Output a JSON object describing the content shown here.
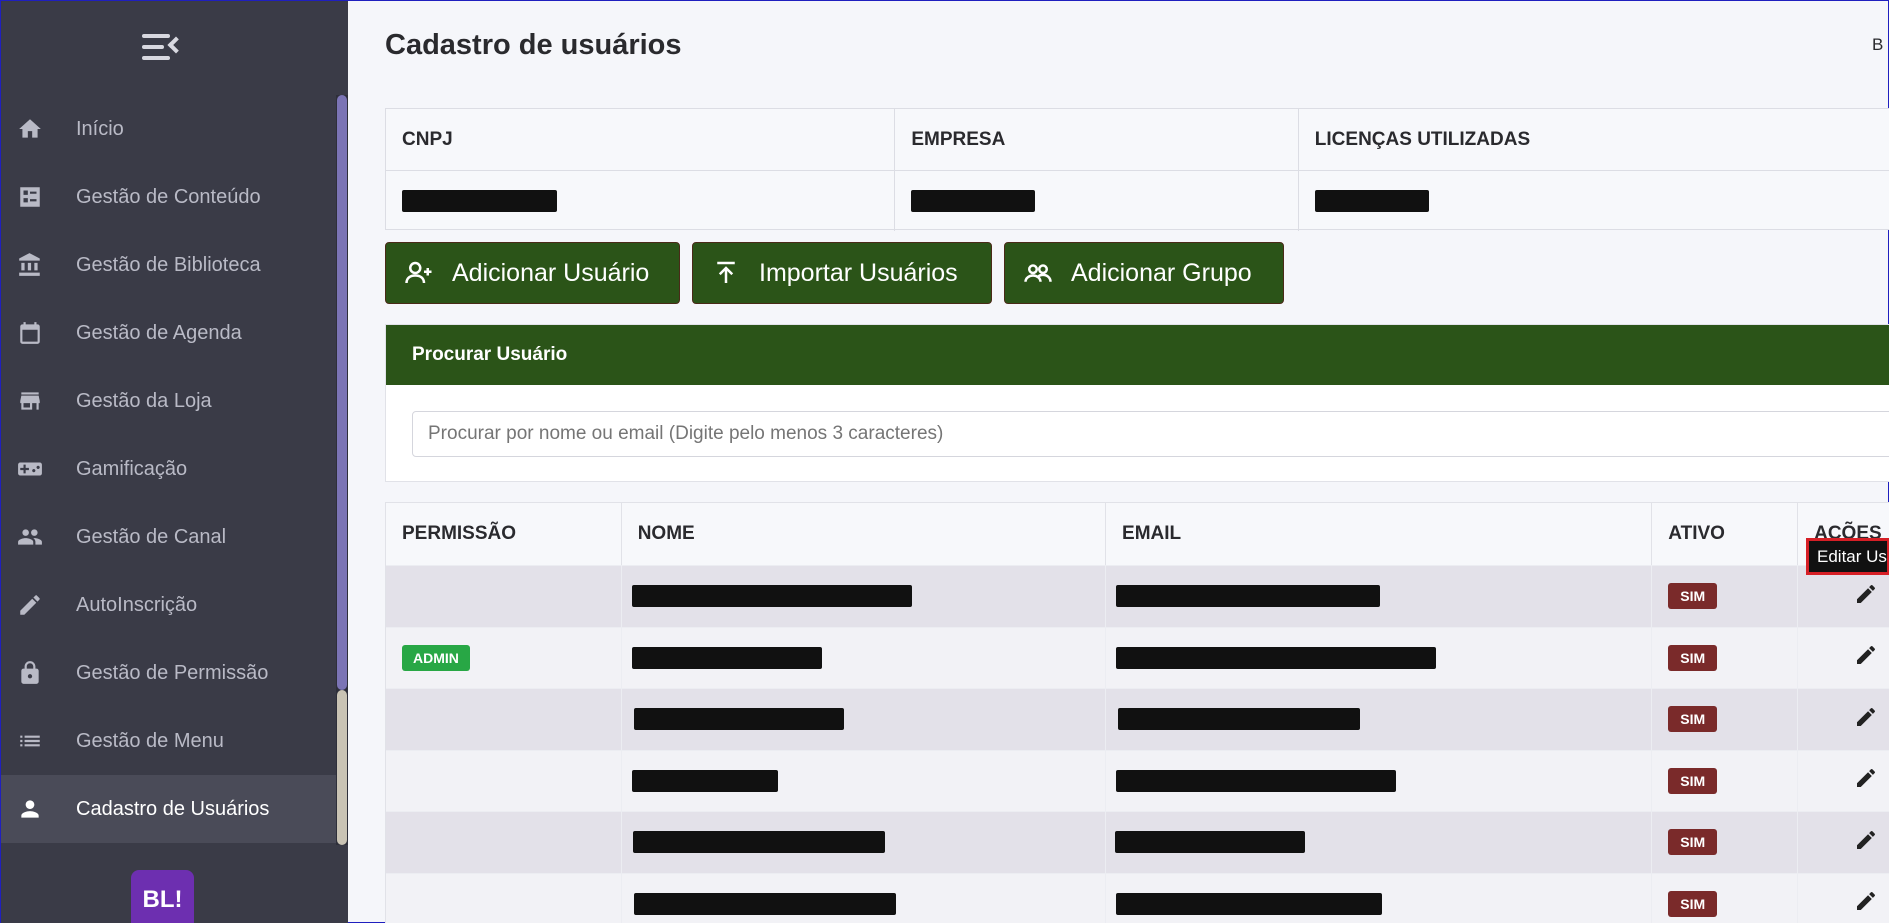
{
  "sidebar": {
    "items": [
      {
        "label": "Início",
        "icon": "home-icon"
      },
      {
        "label": "Gestão de Conteúdo",
        "icon": "content-icon"
      },
      {
        "label": "Gestão de Biblioteca",
        "icon": "library-icon"
      },
      {
        "label": "Gestão de Agenda",
        "icon": "calendar-icon"
      },
      {
        "label": "Gestão da Loja",
        "icon": "store-icon"
      },
      {
        "label": "Gamificação",
        "icon": "gamepad-icon"
      },
      {
        "label": "Gestão de Canal",
        "icon": "people-icon"
      },
      {
        "label": "AutoInscrição",
        "icon": "pencil-icon"
      },
      {
        "label": "Gestão de Permissão",
        "icon": "lock-icon"
      },
      {
        "label": "Gestão de Menu",
        "icon": "list-icon"
      },
      {
        "label": "Cadastro de Usuários",
        "icon": "person-icon",
        "active": true
      }
    ],
    "logo_text": "BL!"
  },
  "header": {
    "title": "Cadastro de usuários",
    "corner_text": "B"
  },
  "info_table": {
    "headers": [
      "CNPJ",
      "EMPRESA",
      "LICENÇAS UTILIZADAS"
    ]
  },
  "actions": {
    "add_user": "Adicionar Usuário",
    "import_users": "Importar Usuários",
    "add_group": "Adicionar Grupo"
  },
  "search": {
    "title": "Procurar Usuário",
    "placeholder": "Procurar por nome ou email (Digite pelo menos 3 caracteres)"
  },
  "users_table": {
    "headers": [
      "PERMISSÃO",
      "NOME",
      "EMAIL",
      "ATIVO",
      "AÇÕES"
    ],
    "rows": [
      {
        "permission": "",
        "active": "SIM"
      },
      {
        "permission": "ADMIN",
        "active": "SIM"
      },
      {
        "permission": "",
        "active": "SIM"
      },
      {
        "permission": "",
        "active": "SIM"
      },
      {
        "permission": "",
        "active": "SIM"
      },
      {
        "permission": "",
        "active": "SIM"
      }
    ]
  },
  "tooltip": {
    "text": "Editar Us"
  },
  "colors": {
    "sidebar_bg": "#3a3b47",
    "primary_green": "#2b5418",
    "admin_badge": "#28a745",
    "active_badge": "#7a2a2a",
    "scroll_accent": "#7b74b5"
  }
}
